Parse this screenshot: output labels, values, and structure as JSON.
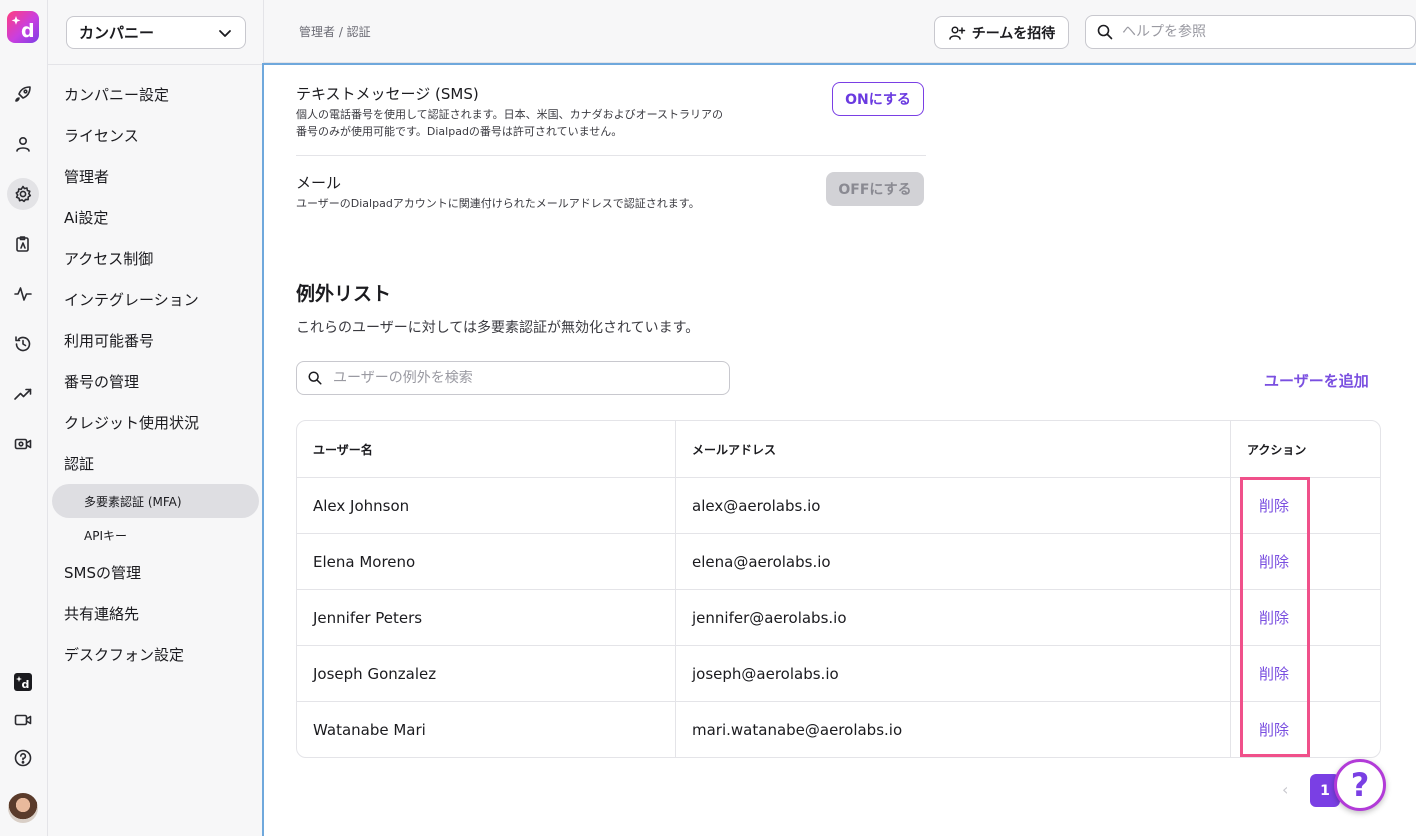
{
  "rail": {
    "logo_letter": "d",
    "icons": [
      "rocket-icon",
      "user-icon",
      "gear-icon",
      "clipboard-icon",
      "activity-icon",
      "history-icon",
      "trending-icon",
      "video-settings-icon",
      "ai-icon",
      "video-icon",
      "help-circle-icon"
    ],
    "active_icon": "gear-icon"
  },
  "sidebar": {
    "company_select": "カンパニー",
    "items": [
      {
        "label": "カンパニー設定"
      },
      {
        "label": "ライセンス"
      },
      {
        "label": "管理者"
      },
      {
        "label": "Ai設定"
      },
      {
        "label": "アクセス制御"
      },
      {
        "label": "インテグレーション"
      },
      {
        "label": "利用可能番号"
      },
      {
        "label": "番号の管理"
      },
      {
        "label": "クレジット使用状況"
      },
      {
        "label": "認証"
      }
    ],
    "sub_items": [
      {
        "label": "多要素認証 (MFA)",
        "active": true
      },
      {
        "label": "APIキー",
        "active": false
      }
    ],
    "items_after": [
      {
        "label": "SMSの管理"
      },
      {
        "label": "共有連絡先"
      },
      {
        "label": "デスクフォン設定"
      }
    ]
  },
  "topbar": {
    "breadcrumb": "管理者 / 認証",
    "invite_label": "チームを招待",
    "help_search_placeholder": "ヘルプを参照"
  },
  "methods": [
    {
      "title": "テキストメッセージ (SMS)",
      "desc_line1": "個人の電話番号を使用して認証されます。日本、米国、カナダおよびオーストラリアの",
      "desc_line2": "番号のみが使用可能です。Dialpadの番号は許可されていません。",
      "button": "ONにする",
      "enabled": false
    },
    {
      "title": "メール",
      "desc_line1": "ユーザーのDialpadアカウントに関連付けられたメールアドレスで認証されます。",
      "button": "OFFにする",
      "enabled": true
    }
  ],
  "exceptions": {
    "title": "例外リスト",
    "description": "これらのユーザーに対しては多要素認証が無効化されています。",
    "search_placeholder": "ユーザーの例外を検索",
    "add_user_label": "ユーザーを追加",
    "columns": [
      "ユーザー名",
      "メールアドレス",
      "アクション"
    ],
    "rows": [
      {
        "name": "Alex Johnson",
        "email": "alex@aerolabs.io",
        "action": "削除"
      },
      {
        "name": "Elena Moreno",
        "email": "elena@aerolabs.io",
        "action": "削除"
      },
      {
        "name": "Jennifer Peters",
        "email": "jennifer@aerolabs.io",
        "action": "削除"
      },
      {
        "name": "Joseph Gonzalez",
        "email": "joseph@aerolabs.io",
        "action": "削除"
      },
      {
        "name": "Watanabe Mari",
        "email": "mari.watanabe@aerolabs.io",
        "action": "削除"
      }
    ]
  },
  "pagination": {
    "prev": "‹",
    "current": "1"
  },
  "help_fab": "?",
  "colors": {
    "accent": "#7a3fe4",
    "highlight": "#f0508a",
    "focus_border": "#6fa8dc"
  }
}
